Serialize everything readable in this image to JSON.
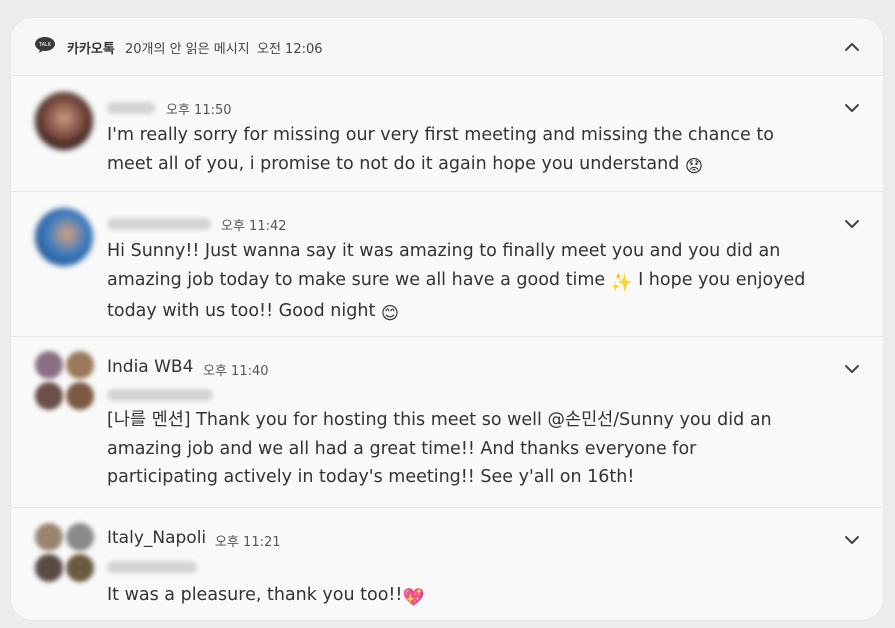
{
  "header": {
    "app_name": "카카오톡",
    "summary": "20개의 안 읽은 메시지",
    "time": "오전 12:06",
    "icon": "kakaotalk-talk-icon",
    "collapse_icon": "chevron-up-icon"
  },
  "messages": [
    {
      "sender": "",
      "time": "오후 11:50",
      "text": "I'm really sorry for missing our very first meeting and missing the chance to meet all of you, i promise to not do it again hope you understand",
      "emoji": "😟"
    },
    {
      "sender": "",
      "time": "오후 11:42",
      "text_before": "Hi Sunny!! Just wanna say it was amazing to finally meet you and you did an amazing job today to make sure we all have a good time ",
      "emoji_mid": "✨",
      "text_after": " I hope you enjoyed today with us too!! Good night ",
      "emoji_end": "😊"
    },
    {
      "sender": "India WB4",
      "time": "오후 11:40",
      "text": "[나를 멘션] Thank you for hosting this meet so well @손민선/Sunny you did an amazing job and we all had a great time!! And thanks everyone for participating actively in today's meeting!! See y'all on 16th!"
    },
    {
      "sender": "Italy_Napoli",
      "time": "오후 11:21",
      "text": "It was a pleasure, thank you too!!",
      "emoji": "💖"
    }
  ],
  "colors": {
    "panel": "#f7f7f7",
    "background": "#ececec",
    "text": "#333333",
    "muted": "#555555"
  }
}
